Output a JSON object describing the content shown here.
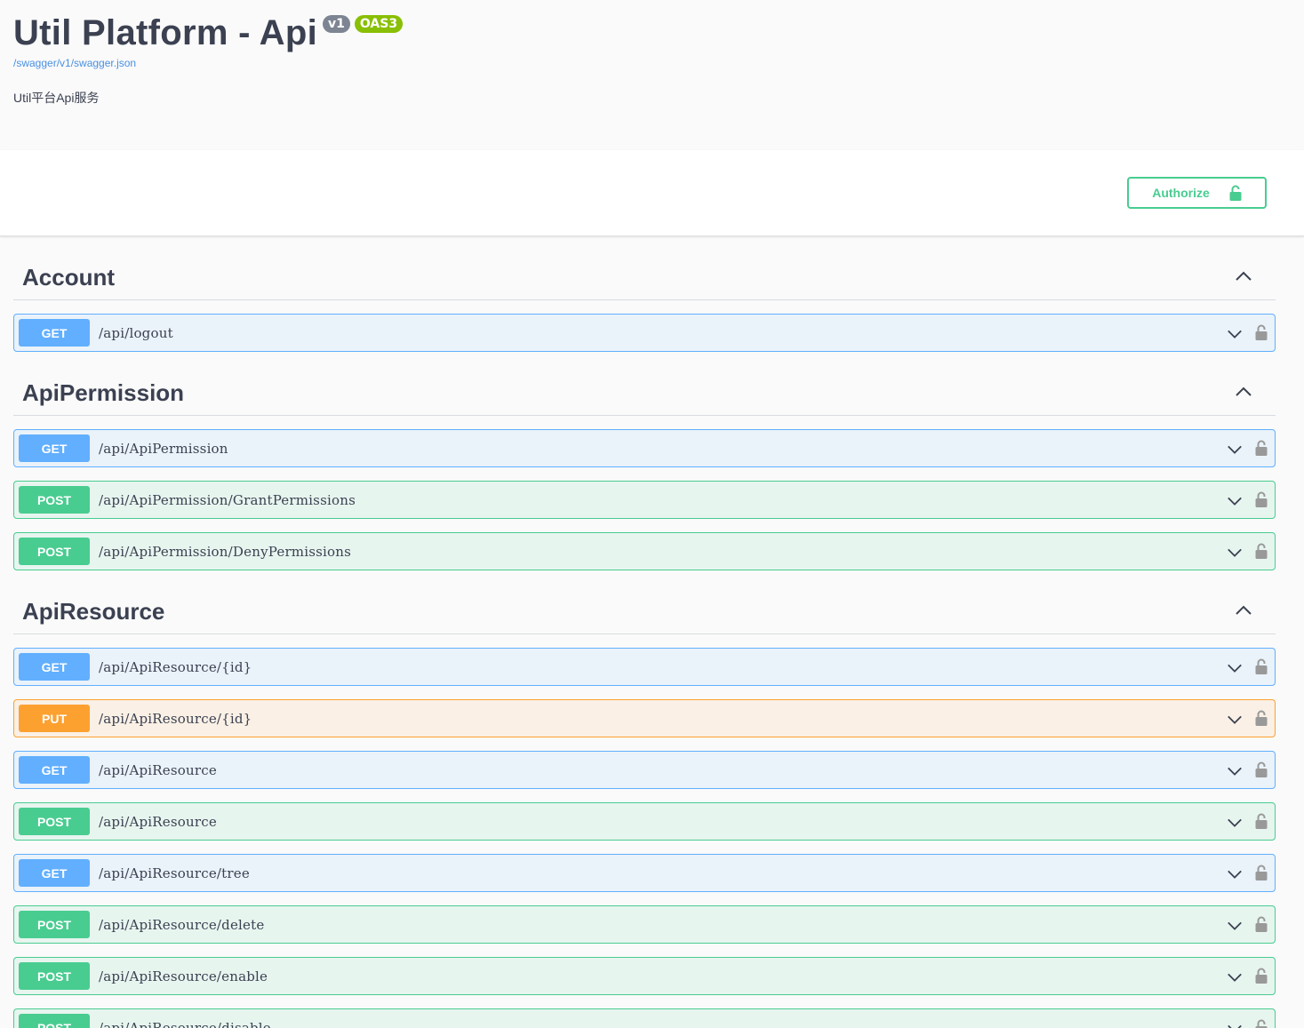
{
  "header": {
    "title": "Util Platform - Api",
    "version_badge": "v1",
    "oas_badge": "OAS3",
    "spec_link": "/swagger/v1/swagger.json",
    "description": "Util平台Api服务"
  },
  "scheme": {
    "authorize_label": "Authorize",
    "authorize_icon": "unlock-icon"
  },
  "colors": {
    "get": "#61affe",
    "post": "#49cc90",
    "put": "#fca130",
    "authorize": "#49cc90",
    "text": "#3b4151"
  },
  "tags": [
    {
      "name": "Account",
      "operations": [
        {
          "method": "GET",
          "path": "/api/logout"
        }
      ]
    },
    {
      "name": "ApiPermission",
      "operations": [
        {
          "method": "GET",
          "path": "/api/ApiPermission"
        },
        {
          "method": "POST",
          "path": "/api/ApiPermission/GrantPermissions"
        },
        {
          "method": "POST",
          "path": "/api/ApiPermission/DenyPermissions"
        }
      ]
    },
    {
      "name": "ApiResource",
      "operations": [
        {
          "method": "GET",
          "path": "/api/ApiResource/{id}"
        },
        {
          "method": "PUT",
          "path": "/api/ApiResource/{id}"
        },
        {
          "method": "GET",
          "path": "/api/ApiResource"
        },
        {
          "method": "POST",
          "path": "/api/ApiResource"
        },
        {
          "method": "GET",
          "path": "/api/ApiResource/tree"
        },
        {
          "method": "POST",
          "path": "/api/ApiResource/delete"
        },
        {
          "method": "POST",
          "path": "/api/ApiResource/enable"
        },
        {
          "method": "POST",
          "path": "/api/ApiResource/disable"
        }
      ]
    }
  ]
}
